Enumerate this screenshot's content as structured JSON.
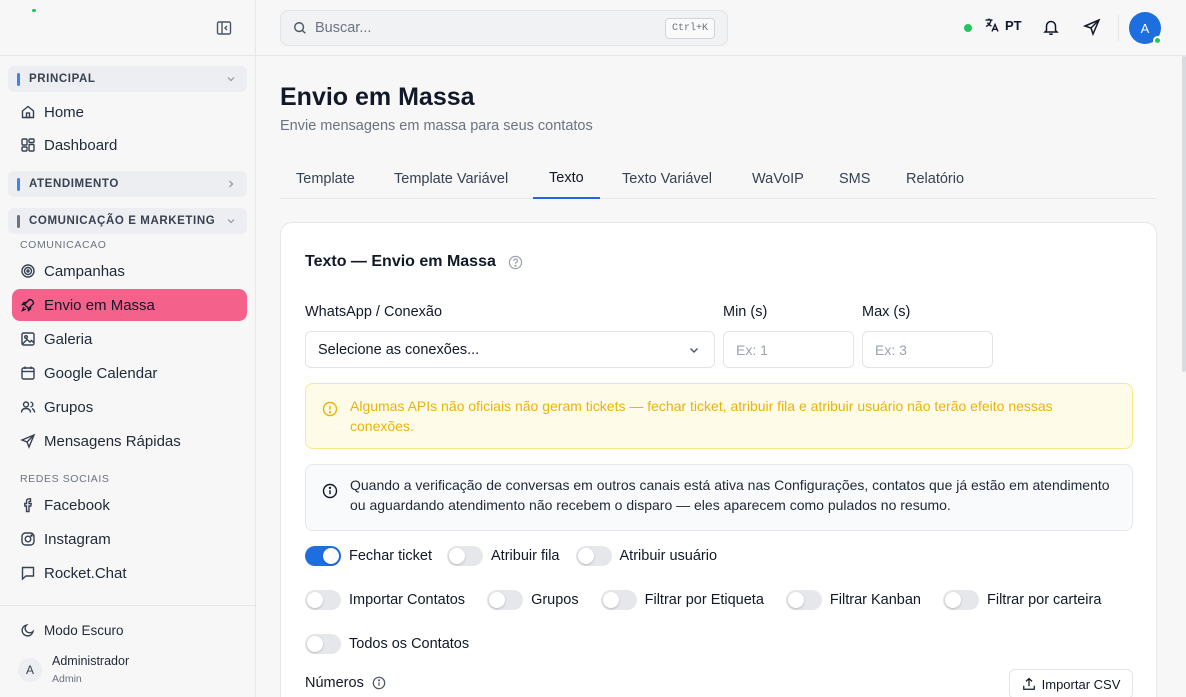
{
  "sidebar": {
    "sections": {
      "principal": "PRINCIPAL",
      "atendimento": "ATENDIMENTO",
      "comunicacao_marketing": "COMUNICAÇÃO E MARKETING"
    },
    "subsections": {
      "comunicacao": "COMUNICACAO",
      "redes_sociais": "REDES SOCIAIS"
    },
    "items": {
      "home": "Home",
      "dashboard": "Dashboard",
      "campanhas": "Campanhas",
      "envio_em_massa": "Envio em Massa",
      "galeria": "Galeria",
      "google_calendar": "Google Calendar",
      "grupos": "Grupos",
      "mensagens_rapidas": "Mensagens Rápidas",
      "facebook": "Facebook",
      "instagram": "Instagram",
      "rocket_chat": "Rocket.Chat"
    },
    "dark_mode": "Modo Escuro",
    "user": {
      "initial": "A",
      "name": "Administrador",
      "role": "Admin"
    }
  },
  "topbar": {
    "search_placeholder": "Buscar...",
    "shortcut": "Ctrl+K",
    "language": "PT",
    "avatar_initial": "A"
  },
  "page": {
    "title": "Envio em Massa",
    "subtitle": "Envie mensagens em massa para seus contatos",
    "tabs": [
      "Template",
      "Template Variável",
      "Texto",
      "Texto Variável",
      "WaVoIP",
      "SMS",
      "Relatório"
    ],
    "active_tab": "Texto"
  },
  "card": {
    "title": "Texto — Envio em Massa",
    "connection_label": "WhatsApp / Conexão",
    "connection_placeholder": "Selecione as conexões...",
    "min_label": "Min (s)",
    "min_placeholder": "Ex: 1",
    "max_label": "Max (s)",
    "max_placeholder": "Ex: 3",
    "warning_text": "Algumas APIs não oficiais não geram tickets — fechar ticket, atribuir fila e atribuir usuário não terão efeito nessas conexões.",
    "info_text": "Quando a verificação de conversas em outros canais está ativa nas Configurações, contatos que já estão em atendimento ou aguardando atendimento não recebem o disparo — eles aparecem como pulados no resumo.",
    "toggles": {
      "fechar_ticket": {
        "label": "Fechar ticket",
        "on": true
      },
      "atribuir_fila": {
        "label": "Atribuir fila",
        "on": false
      },
      "atribuir_usuario": {
        "label": "Atribuir usuário",
        "on": false
      },
      "importar_contatos": {
        "label": "Importar Contatos",
        "on": false
      },
      "grupos": {
        "label": "Grupos",
        "on": false
      },
      "filtrar_etiqueta": {
        "label": "Filtrar por Etiqueta",
        "on": false
      },
      "filtrar_kanban": {
        "label": "Filtrar Kanban",
        "on": false
      },
      "filtrar_carteira": {
        "label": "Filtrar por carteira",
        "on": false
      },
      "todos_contatos": {
        "label": "Todos os Contatos",
        "on": false
      }
    },
    "numbers_label": "Números",
    "import_csv": "Importar CSV"
  },
  "colors": {
    "accent": "#1d6fe0",
    "active_nav": "#f4628b",
    "principal_bar": "#3b82f6",
    "atendimento_bar": "#3b82f6",
    "comunicacao_bar": "#6b7280",
    "warning": "#eab308",
    "online": "#22c55e"
  }
}
